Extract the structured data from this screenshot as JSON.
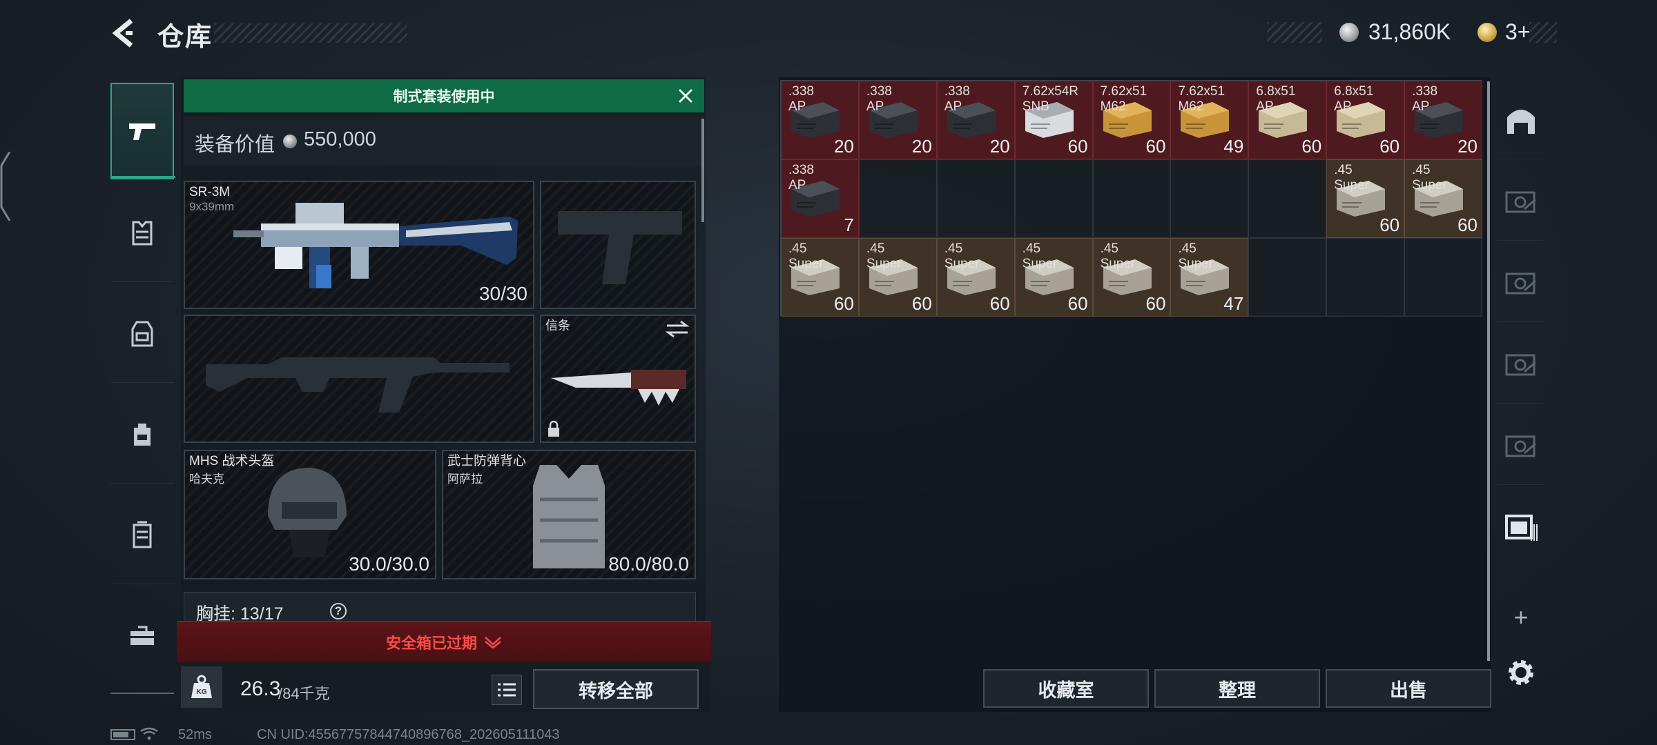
{
  "header": {
    "title": "仓库",
    "silver": "31,860K",
    "gold": "3+"
  },
  "sidebar_left": {
    "items": [
      {
        "name": "weapons"
      },
      {
        "name": "armor"
      },
      {
        "name": "rig"
      },
      {
        "name": "backpack"
      },
      {
        "name": "container"
      },
      {
        "name": "toolbox"
      }
    ]
  },
  "loadout": {
    "banner": "制式套装使用中",
    "value_label": "装备价值",
    "value": "550,000",
    "primary": {
      "name": "SR-3M",
      "caliber": "9x39mm",
      "durability": "30/30"
    },
    "melee": {
      "title": "信条"
    },
    "helmet": {
      "name": "MHS 战术头盔",
      "sub": "哈夫克",
      "durability": "30.0/30.0"
    },
    "armor": {
      "name": "武士防弹背心",
      "sub": "阿萨拉",
      "durability": "80.0/80.0"
    },
    "vest": {
      "label": "胸挂:",
      "value": "13/17",
      "help": "?"
    },
    "expired": "安全箱已过期",
    "weight_current": "26.3",
    "weight_max": "/84千克",
    "transfer_all": "转移全部"
  },
  "status": {
    "ping": "52ms",
    "uid": "CN UID:4556775784474089676​8_202605111043"
  },
  "storage": {
    "cells": [
      {
        "l1": ".338",
        "l2": "AP",
        "qty": "20",
        "tone": "red",
        "img": "dark"
      },
      {
        "l1": ".338",
        "l2": "AP",
        "qty": "20",
        "tone": "red",
        "img": "dark"
      },
      {
        "l1": ".338",
        "l2": "AP",
        "qty": "20",
        "tone": "red",
        "img": "dark"
      },
      {
        "l1": "7.62x54R",
        "l2": "SNB",
        "qty": "60",
        "tone": "red",
        "img": "white"
      },
      {
        "l1": "7.62x51",
        "l2": "M62",
        "qty": "60",
        "tone": "red",
        "img": "yellow"
      },
      {
        "l1": "7.62x51",
        "l2": "M62",
        "qty": "49",
        "tone": "red",
        "img": "yellow"
      },
      {
        "l1": "6.8x51",
        "l2": "AP",
        "qty": "60",
        "tone": "red",
        "img": "beige"
      },
      {
        "l1": "6.8x51",
        "l2": "AP",
        "qty": "60",
        "tone": "red",
        "img": "beige"
      },
      {
        "l1": ".338",
        "l2": "AP",
        "qty": "20",
        "tone": "red",
        "img": "dark"
      },
      {
        "l1": ".338",
        "l2": "AP",
        "qty": "7",
        "tone": "red",
        "img": "dark"
      },
      {
        "empty": true
      },
      {
        "empty": true
      },
      {
        "empty": true
      },
      {
        "empty": true
      },
      {
        "empty": true
      },
      {
        "empty": true
      },
      {
        "l1": ".45",
        "l2": "Super",
        "qty": "60",
        "tone": "brn",
        "img": "steel"
      },
      {
        "l1": ".45",
        "l2": "Super",
        "qty": "60",
        "tone": "brn",
        "img": "steel"
      },
      {
        "l1": ".45",
        "l2": "Super",
        "qty": "60",
        "tone": "brn",
        "img": "steel"
      },
      {
        "l1": ".45",
        "l2": "Super",
        "qty": "60",
        "tone": "brn",
        "img": "steel"
      },
      {
        "l1": ".45",
        "l2": "Super",
        "qty": "60",
        "tone": "brn",
        "img": "steel"
      },
      {
        "l1": ".45",
        "l2": "Super",
        "qty": "60",
        "tone": "brn",
        "img": "steel"
      },
      {
        "l1": ".45",
        "l2": "Super",
        "qty": "60",
        "tone": "brn",
        "img": "steel"
      },
      {
        "l1": ".45",
        "l2": "Super",
        "qty": "47",
        "tone": "brn",
        "img": "steel"
      },
      {
        "empty": true
      },
      {
        "empty": true
      },
      {
        "empty": true
      }
    ],
    "buttons": {
      "collection": "收藏室",
      "sort": "整理",
      "sell": "出售"
    }
  },
  "colors": {
    "accent": "#2ea58a",
    "banner": "#0f6b43",
    "danger": "#ff4a4a",
    "cell_red": "#4e1a1f",
    "cell_brown": "#3f3227"
  }
}
